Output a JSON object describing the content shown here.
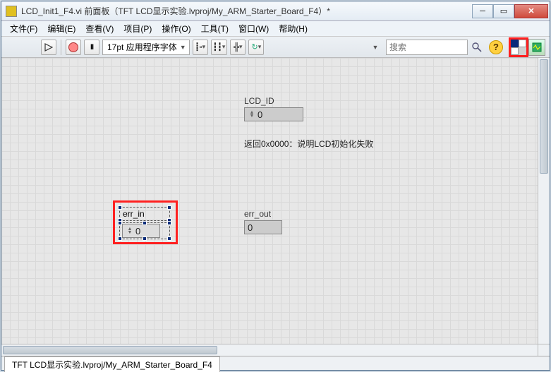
{
  "window": {
    "title": "LCD_Init1_F4.vi 前面板（TFT LCD显示实验.lvproj/My_ARM_Starter_Board_F4）*"
  },
  "menus": {
    "file": "文件(F)",
    "edit": "编辑(E)",
    "view": "查看(V)",
    "project": "项目(P)",
    "operate": "操作(O)",
    "tools": "工具(T)",
    "window": "窗口(W)",
    "help": "帮助(H)"
  },
  "toolbar": {
    "font_label": "17pt 应用程序字体",
    "search_placeholder": "搜索",
    "help_symbol": "?"
  },
  "canvas": {
    "lcd_id_label": "LCD_ID",
    "lcd_id_value": "0",
    "info_text": "返回0x0000：说明LCD初始化失败",
    "err_in_label": "err_in",
    "err_in_value": "0",
    "err_out_label": "err_out",
    "err_out_value": "0"
  },
  "status": {
    "tab": "TFT LCD显示实验.lvproj/My_ARM_Starter_Board_F4"
  }
}
